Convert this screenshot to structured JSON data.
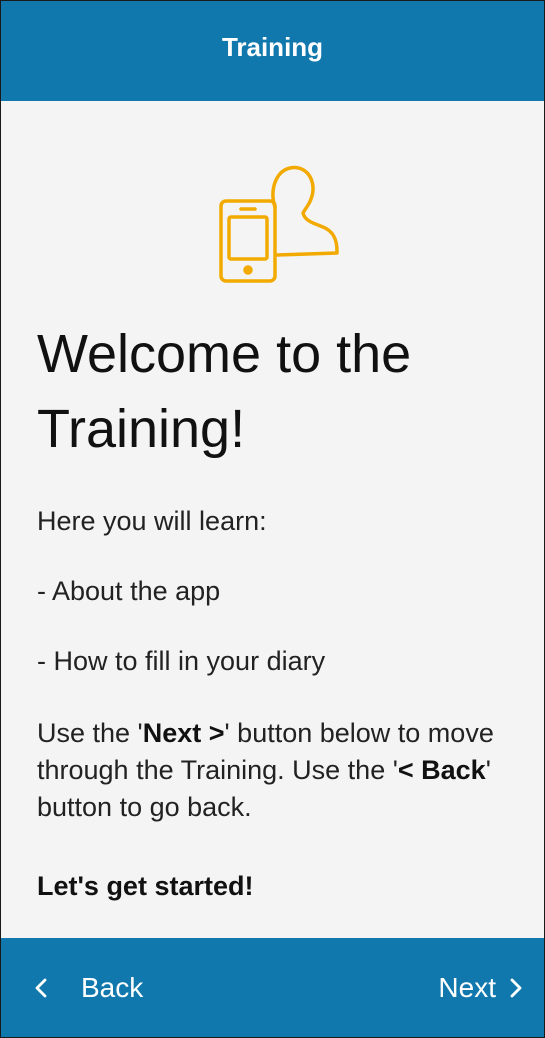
{
  "header": {
    "title": "Training"
  },
  "illustration": {
    "icon": "phone-user-icon",
    "color": "#f2a900"
  },
  "main": {
    "title": "Welcome to the Training!",
    "intro": "Here you will learn:",
    "items": [
      "- About the app",
      "- How to fill in your diary"
    ],
    "instructions": {
      "part1": "Use the '",
      "next_ref": "Next >",
      "part2": "' button below to move through the Training. Use the '",
      "back_ref": "< Back",
      "part3": "' button to go back."
    },
    "closing": "Let's get started!"
  },
  "footer": {
    "back_label": "Back",
    "next_label": "Next"
  },
  "colors": {
    "primary": "#1178ad",
    "background": "#f4f4f4",
    "accent": "#f2a900"
  }
}
